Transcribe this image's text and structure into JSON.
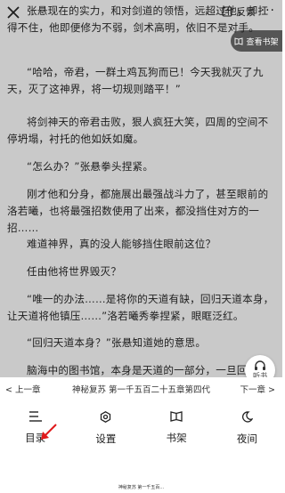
{
  "topbar": {
    "feedback_label": "反馈",
    "more_label": "···"
  },
  "shelf_button": {
    "label": "查看书架"
  },
  "listen_button": {
    "label": "听书"
  },
  "paragraphs": [
    "张悬现在的实力，和对剑道的领悟，远超过他，却扛得不住，他即便修为不弱，剑术高明，依旧不是对手。",
    "“哈哈，帝君，一群土鸡瓦狗而已！今天我就灭了九天，灭了这神界，将一切规则踏平！”",
    "将剑神天的帝君击败，狠人疯狂大笑，四周的空间不停坍塌，衬托的他如妖如魔。",
    "“怎么办？”张悬拳头捏紧。",
    "刚才他和分身，都施展出最强战斗力了，甚至眼前的洛若曦，也将最强招数使用了出来，都没挡住对方的一招……",
    "难道神界，真的没人能够挡住眼前这位？",
    "任由他将世界毁灭？",
    "“唯一的办法……是将你的天道有缺，回归天道本身，让天道将他镇压……”洛若曦秀拳捏紧，眼眶泛红。",
    "“回归天道本身？”张悬知道她的意思。",
    "脑海中的图书馆，本身是天道的一部分，一旦回归，天道等于彻底完整了，或许就可以修复漏洞，自我将狠人排斥出去。"
  ],
  "chapter_nav": {
    "prev_label": "< 上一章",
    "chapter_title": "神秘复苏 第一千五百二十五章第四代",
    "next_label": "下一章 >"
  },
  "tabs": [
    {
      "label": "目录",
      "icon": "list-icon"
    },
    {
      "label": "设置",
      "icon": "gear-icon"
    },
    {
      "label": "书架",
      "icon": "book-icon"
    },
    {
      "label": "夜间",
      "icon": "moon-icon"
    }
  ],
  "bottom_strip": {
    "text": "神秘复苏 第一千五百..."
  },
  "colors": {
    "reader_bg": "#c9c9c9",
    "annotation_arrow": "#e0191b"
  }
}
